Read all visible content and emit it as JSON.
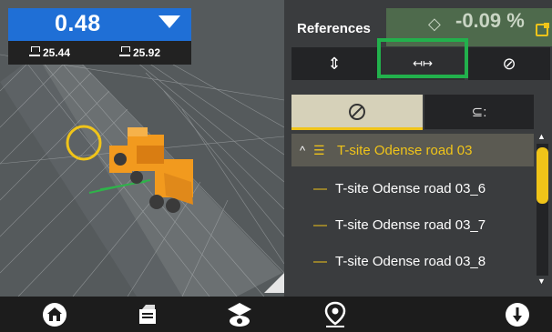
{
  "elevation": {
    "value": "0.48",
    "left_blade": "25.44",
    "right_blade": "25.92"
  },
  "deviation": {
    "value": "-0.09 %"
  },
  "references": {
    "title": "References",
    "modes": [
      {
        "icon": "vertical-reference-icon",
        "glyph": "⇕"
      },
      {
        "icon": "horizontal-reference-icon",
        "glyph": "↤↦"
      },
      {
        "icon": "slope-reference-icon",
        "glyph": "⊘"
      }
    ],
    "tabs": [
      {
        "icon": "no-reference-icon"
      },
      {
        "icon": "magnet-reference-icon",
        "glyph": "⊆:"
      }
    ],
    "items": [
      {
        "label": "T-site Odense road 03",
        "selected": true,
        "expanded": true
      },
      {
        "label": "T-site Odense road 03_6",
        "selected": false
      },
      {
        "label": "T-site Odense road 03_7",
        "selected": false
      },
      {
        "label": "T-site Odense road 03_8",
        "selected": false
      }
    ]
  },
  "bottom_nav": [
    {
      "icon": "home-icon"
    },
    {
      "icon": "reports-icon"
    },
    {
      "icon": "view-eye-icon"
    },
    {
      "icon": "location-pin-icon"
    },
    {
      "icon": "info-alert-icon"
    }
  ],
  "colors": {
    "accent": "#f0c419",
    "primary_blue": "#1f6fd6",
    "highlight_green": "#22b14c"
  }
}
